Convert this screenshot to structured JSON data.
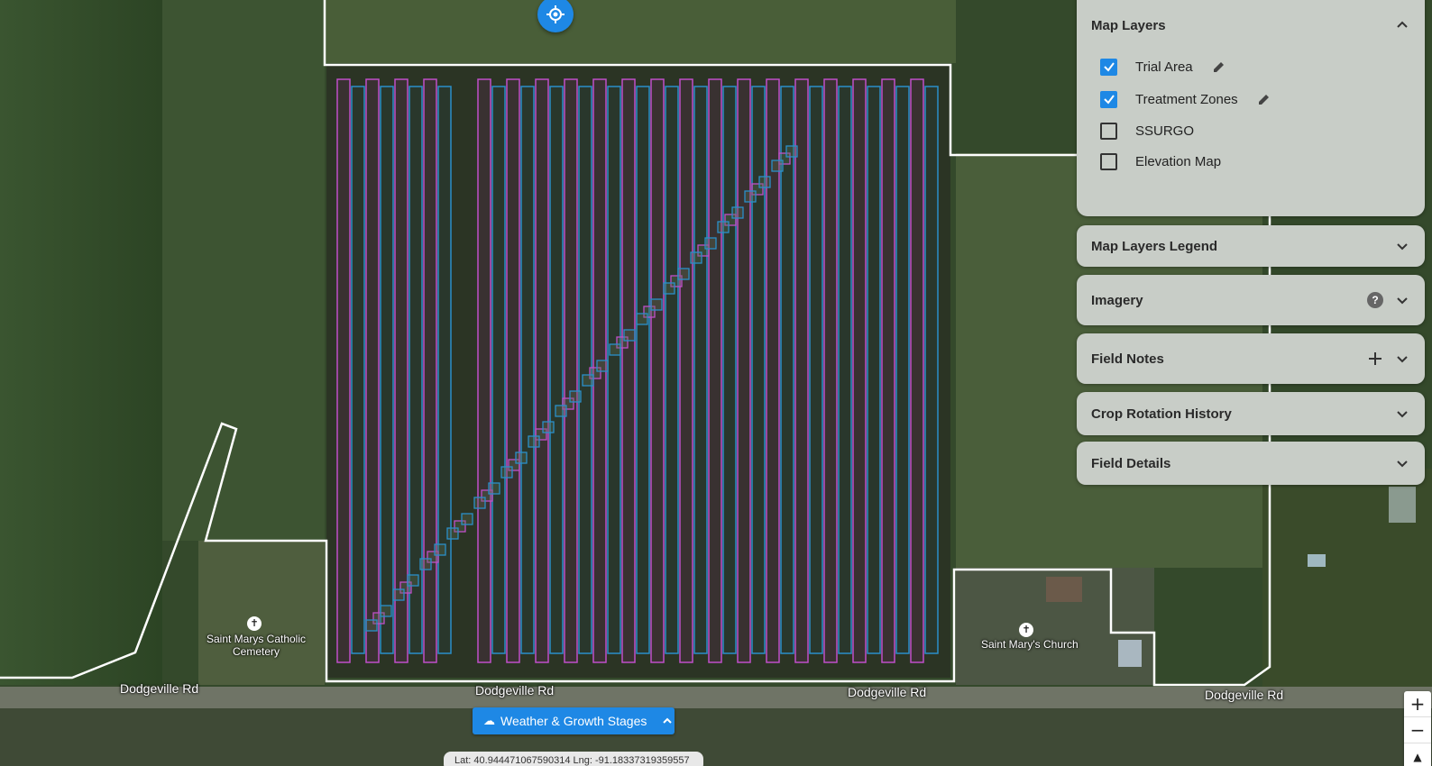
{
  "map": {
    "roads": [
      "Dodgeville Rd",
      "Dodgeville Rd",
      "Dodgeville Rd",
      "Dodgeville Rd"
    ],
    "pois": [
      {
        "name": "Saint Marys Catholic\nCemetery",
        "icon": "cemetery-icon"
      },
      {
        "name": "Saint Mary's Church",
        "icon": "church-icon"
      }
    ],
    "colors": {
      "trial_area": "#ffffff",
      "zone_magenta": "#c04fc9",
      "zone_blue": "#2a8fc9"
    }
  },
  "layers_panel": {
    "title": "Map Layers",
    "items": [
      {
        "label": "Trial Area",
        "checked": true,
        "editable": true
      },
      {
        "label": "Treatment Zones",
        "checked": true,
        "editable": true
      },
      {
        "label": "SSURGO",
        "checked": false,
        "editable": false
      },
      {
        "label": "Elevation Map",
        "checked": false,
        "editable": false
      }
    ]
  },
  "sections": [
    {
      "title": "Map Layers Legend"
    },
    {
      "title": "Imagery"
    },
    {
      "title": "Field Notes"
    },
    {
      "title": "Crop Rotation History"
    },
    {
      "title": "Field Details"
    }
  ],
  "weather": {
    "label": "Weather & Growth Stages"
  },
  "zoom": {
    "in": "+",
    "out": "−"
  },
  "coords": "Lat: 40.944471067590314 Lng: -91.18337319359557",
  "accent": "#1e88e5"
}
